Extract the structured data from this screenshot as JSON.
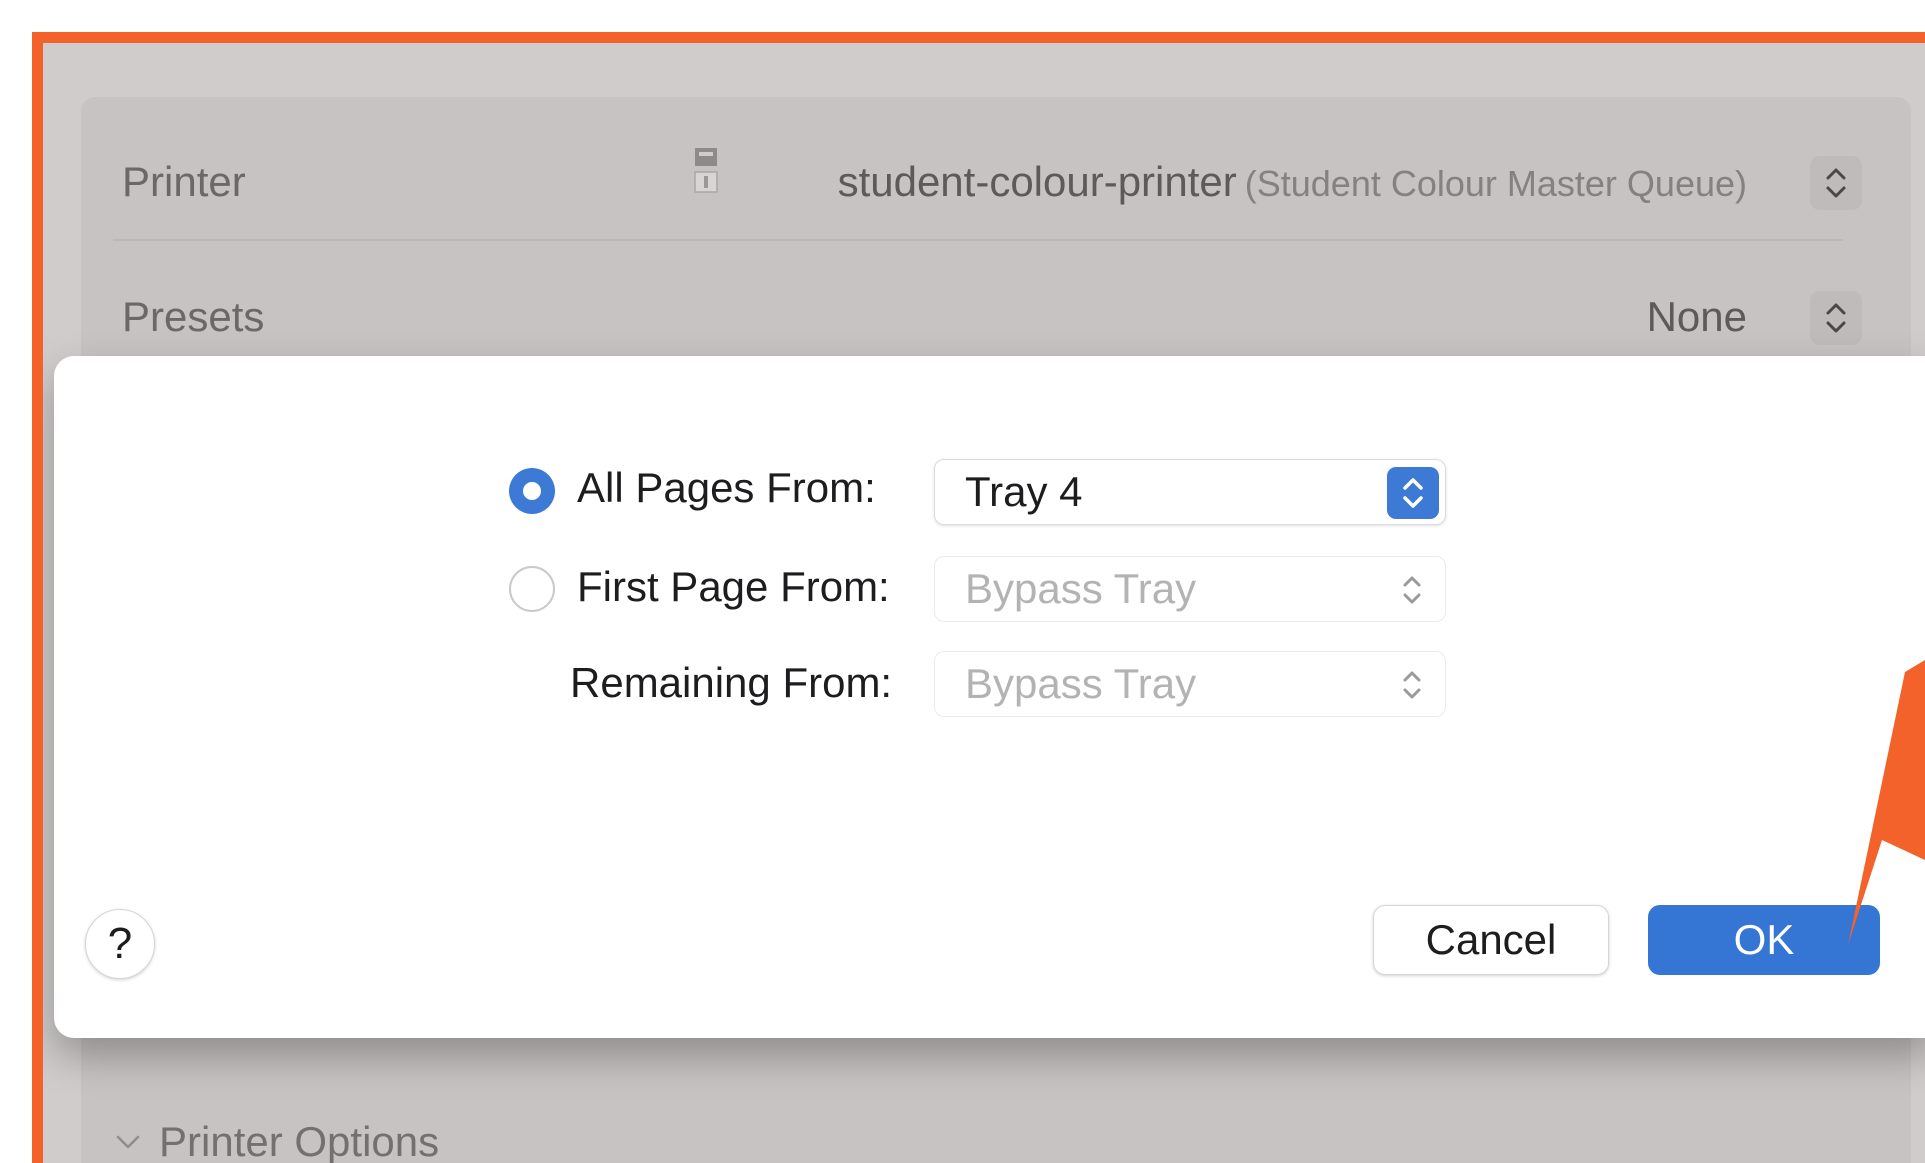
{
  "background_dialog": {
    "printer_label": "Printer",
    "printer_name": "student-colour-printer",
    "printer_queue": "(Student Colour Master Queue)",
    "presets_label": "Presets",
    "presets_value": "None",
    "printer_options_label": "Printer Options"
  },
  "paper_feed": {
    "all_pages": {
      "label": "All Pages From:",
      "selected": true,
      "value": "Tray 4"
    },
    "first_page": {
      "label": "First Page From:",
      "selected": false,
      "value": "Bypass Tray"
    },
    "remaining": {
      "label": "Remaining From:",
      "value": "Bypass Tray"
    }
  },
  "buttons": {
    "help": "?",
    "cancel": "Cancel",
    "ok": "OK"
  },
  "colors": {
    "highlight": "#f2622a",
    "accent": "#3575d3"
  }
}
